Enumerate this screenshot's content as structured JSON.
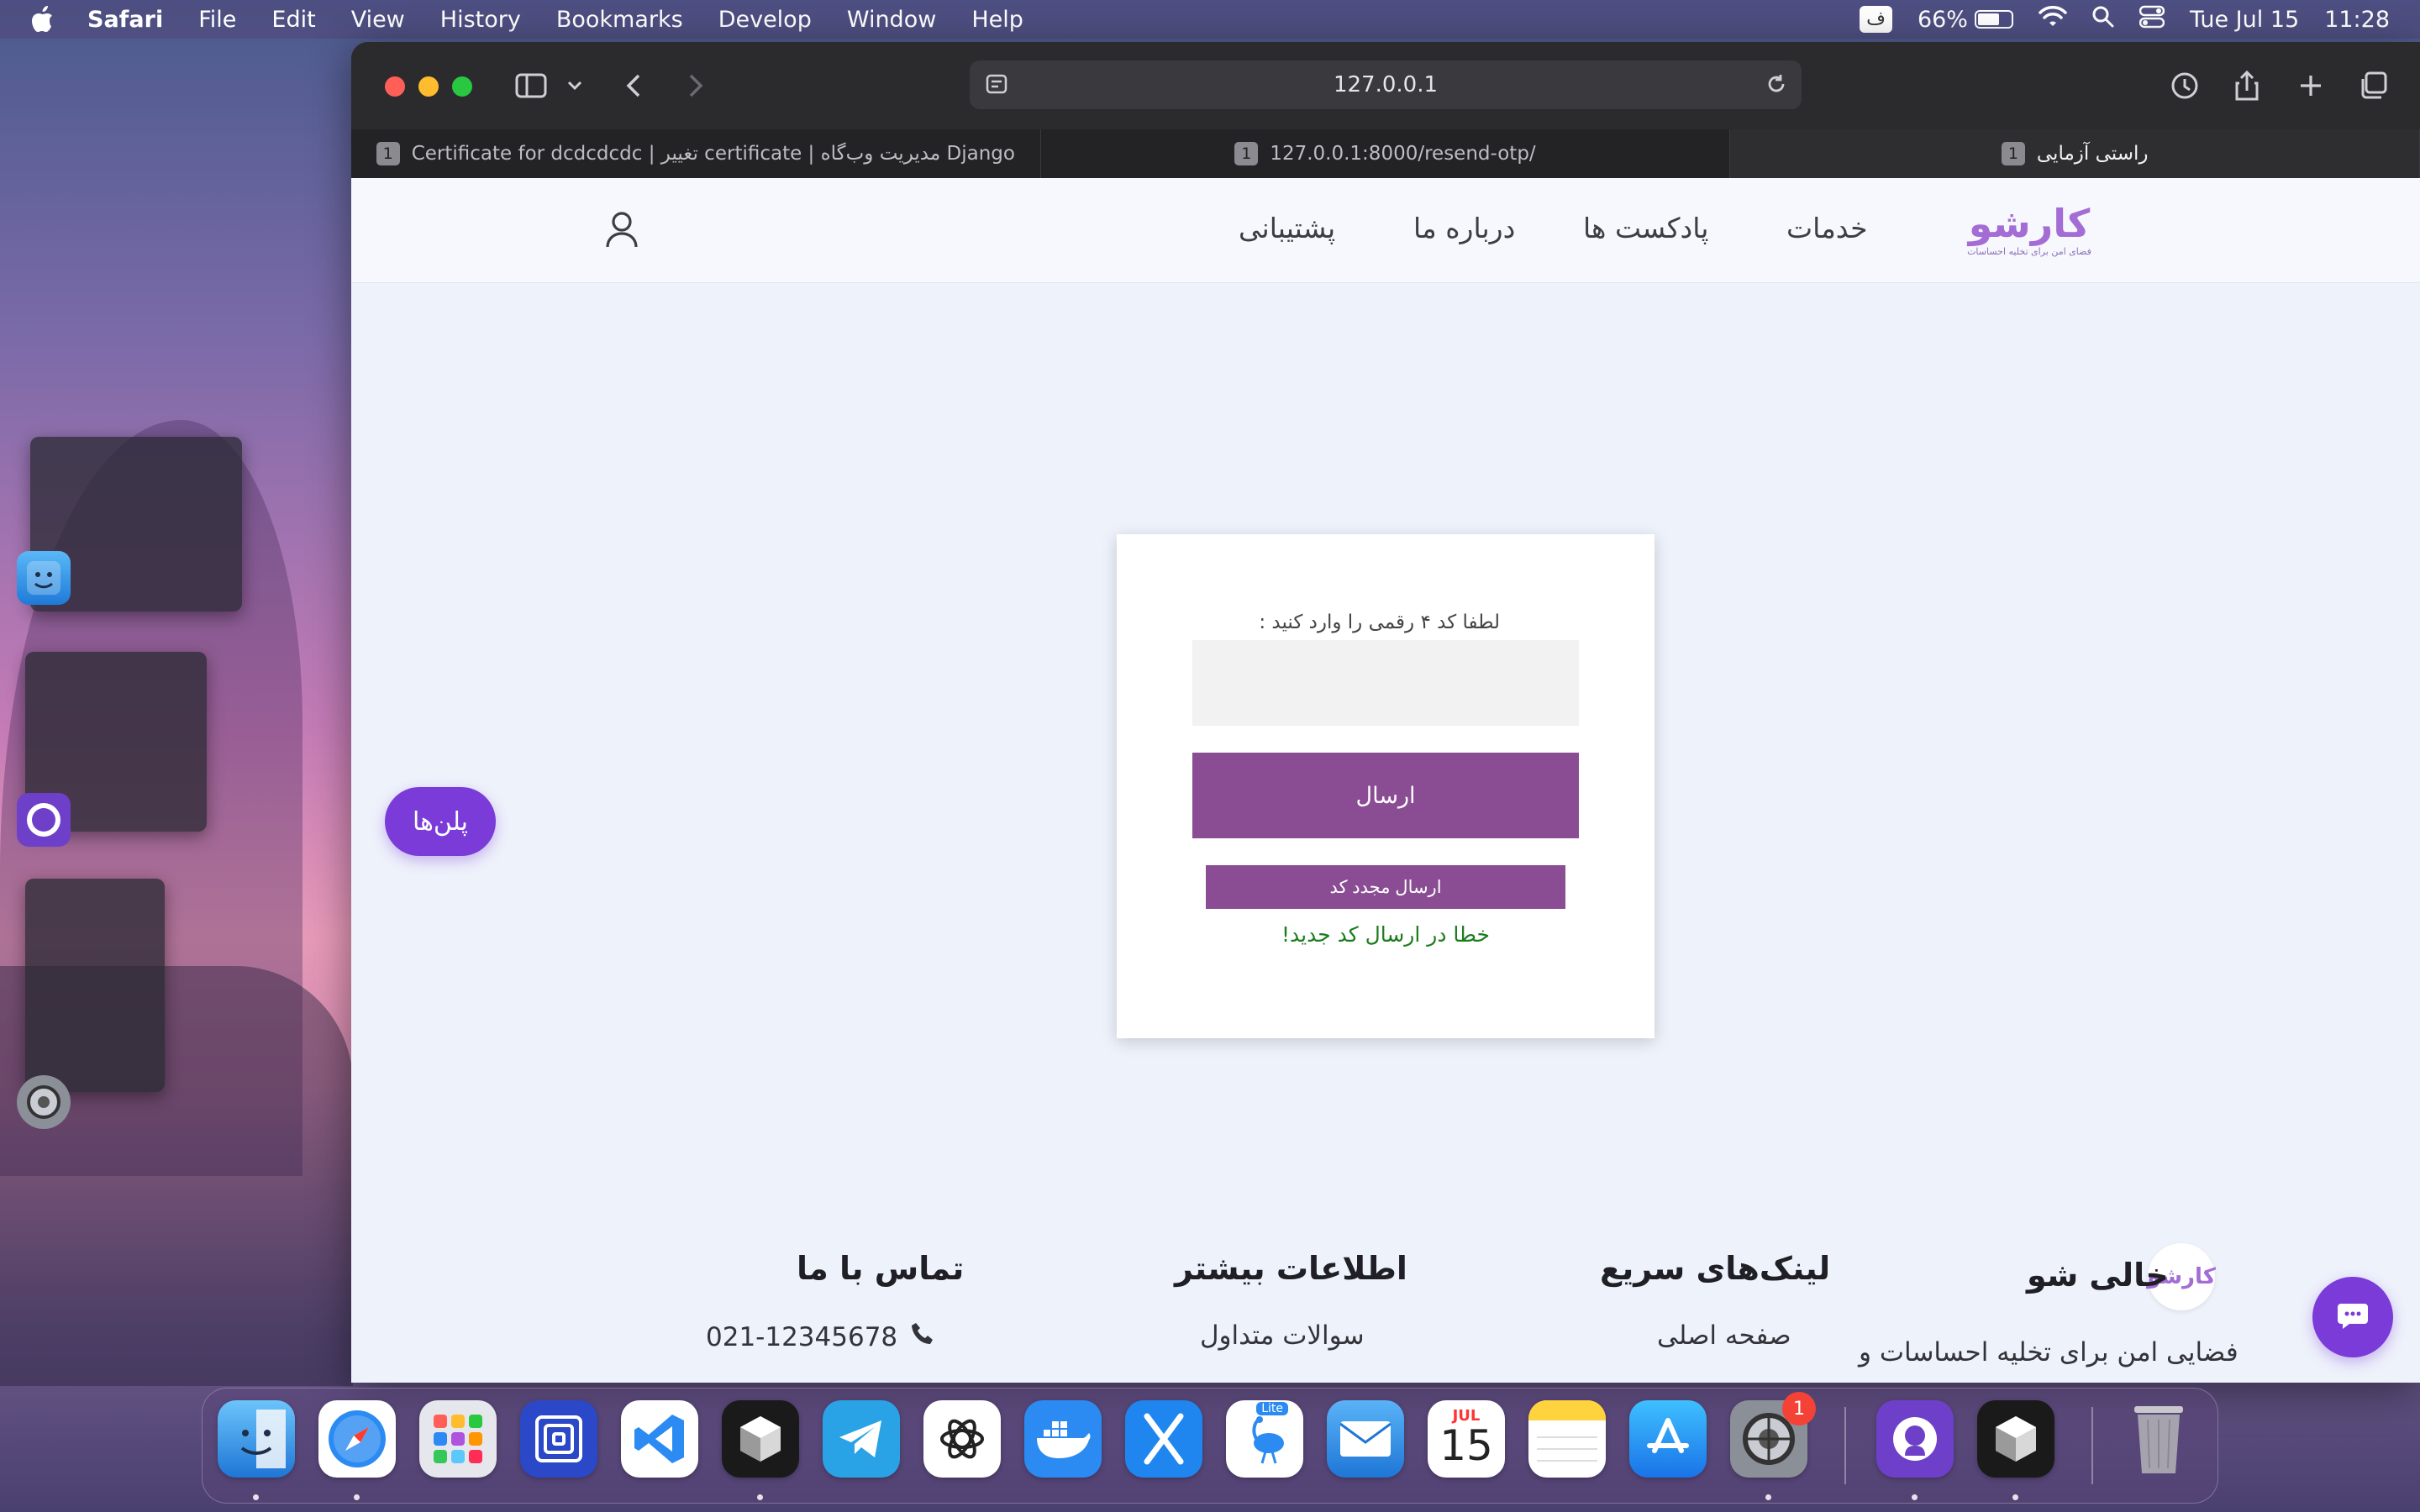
{
  "menubar": {
    "app_name": "Safari",
    "items": [
      "File",
      "Edit",
      "View",
      "History",
      "Bookmarks",
      "Develop",
      "Window",
      "Help"
    ],
    "input_source": "ف",
    "battery": "66%",
    "battery_level": 0.66,
    "date": "Tue Jul 15",
    "time": "11:28"
  },
  "browser": {
    "url": "127.0.0.1",
    "tabs": [
      {
        "label": "Certificate for dcdcdcdc | تغییر certificate | مدیریت وب‌گاه Django",
        "count": "1"
      },
      {
        "label": "127.0.0.1:8000/resend-otp/",
        "count": "1"
      },
      {
        "label": "راستی آزمایی",
        "count": "1"
      }
    ]
  },
  "site": {
    "brand": {
      "logo_text": "کارشو",
      "tagline": "فضای امن برای تخلیه احساسات"
    },
    "nav": {
      "services": "خدمات",
      "podcasts": "پادکست ها",
      "about": "درباره ما",
      "support": "پشتیبانی"
    },
    "otp_form": {
      "prompt": "لطفا کد ۴ رقمی را وارد کنید :",
      "input_value": "",
      "submit_label": "ارسال",
      "resend_label": "ارسال مجدد کد",
      "message": "خطا در ارسال کد جدید!"
    },
    "plans_button": "پلن‌ها",
    "footer": {
      "about_title": "خالی شو",
      "about_text": "فضایی امن برای تخلیه احساسات و",
      "logo_text": "کارشو",
      "quick_links_title": "لینک‌های سریع",
      "quick_links": [
        "صفحه اصلی"
      ],
      "more_info_title": "اطلاعات بیشتر",
      "more_info": [
        "سوالات متداول"
      ],
      "contact_title": "تماس با ما",
      "phone": "021-12345678"
    }
  },
  "dock": {
    "calendar_month": "JUL",
    "calendar_day": "15",
    "settings_badge": "1",
    "lite_label": "Lite"
  },
  "colors": {
    "brand_purple": "#8a4c93",
    "accent_violet": "#7a3bd8",
    "success_green": "#1d7d1d"
  }
}
